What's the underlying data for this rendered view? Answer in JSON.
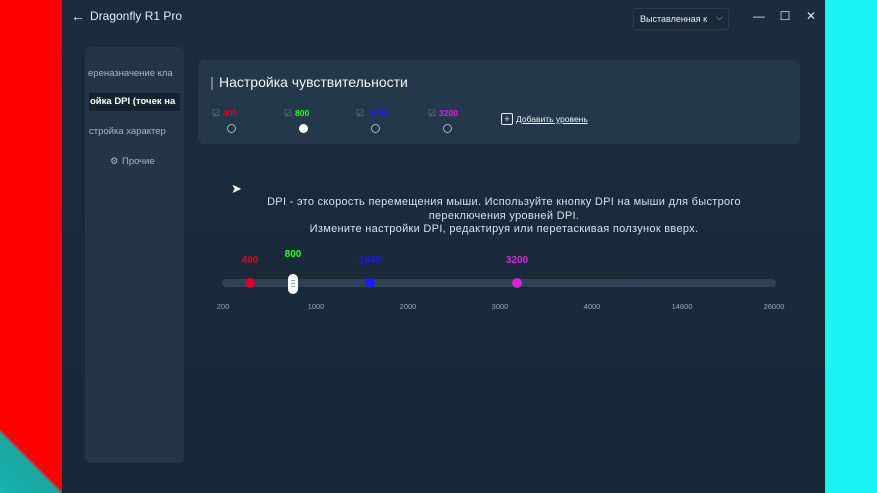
{
  "window": {
    "title": "Dragonfly R1 Pro",
    "profile_select": "Выставленная к",
    "controls": [
      "—",
      "☐",
      "✕"
    ]
  },
  "sidebar": {
    "items": [
      {
        "label": "ереназначение кла"
      },
      {
        "label": "ойка DPI (точек на"
      },
      {
        "label": "стройка характер"
      },
      {
        "label": "Прочие"
      }
    ],
    "active_index": 1
  },
  "card": {
    "title": "Настройка чувствительности",
    "levels": [
      {
        "value": "400",
        "color": "#e00023",
        "selected": false
      },
      {
        "value": "800",
        "color": "#22ff22",
        "selected": true
      },
      {
        "value": "1600",
        "color": "#1a1aff",
        "selected": false
      },
      {
        "value": "3200",
        "color": "#e020e0",
        "selected": false
      }
    ],
    "add_level": "Добавить уровень"
  },
  "description": {
    "line1": "DPI - это скорость перемещения мыши. Используйте кнопку DPI на мыши для быстрого",
    "line2": "переключения уровней DPI.",
    "line3": "Измените настройки DPI, редактируя или перетаскивая ползунок вверх."
  },
  "slider": {
    "points": [
      {
        "label": "400",
        "color": "#e00023",
        "value": 400
      },
      {
        "label": "800",
        "color": "#22ff22",
        "value": 800,
        "active": true
      },
      {
        "label": "1600",
        "color": "#1a1aff",
        "value": 1600
      },
      {
        "label": "3200",
        "color": "#e020e0",
        "value": 3200
      }
    ],
    "ticks": [
      "200",
      "1000",
      "2000",
      "3000",
      "4000",
      "14800",
      "26000"
    ]
  },
  "icons": {
    "back": "arrow-left-icon",
    "chevron": "chevron-down-icon",
    "settings": "gear-icon",
    "add": "plus-box-icon",
    "checkbox": "checkbox-icon",
    "cursor": "mouse-pointer-icon"
  }
}
